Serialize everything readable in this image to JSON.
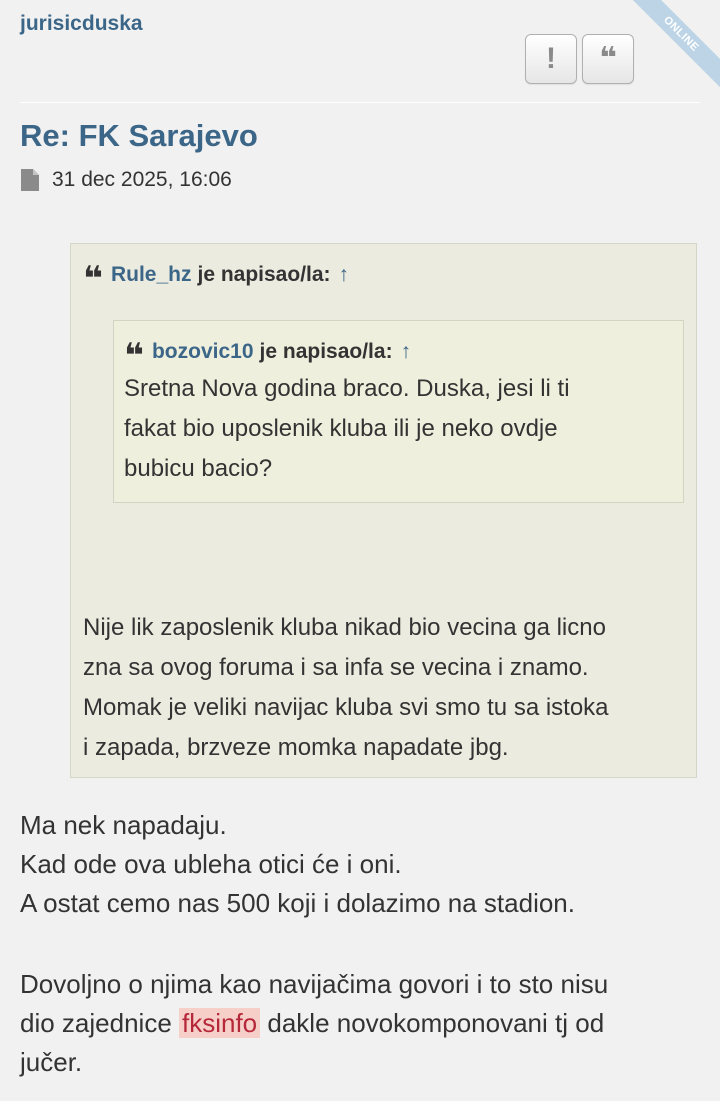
{
  "post": {
    "author": "jurisicduska",
    "online_label": "ONLINE",
    "buttons": {
      "report_glyph": "!",
      "quote_glyph": "❝"
    },
    "title": "Re: FK Sarajevo",
    "date": "31 dec 2025, 16:06",
    "icons": {
      "file": "file-icon",
      "quote": "quote-icon"
    }
  },
  "quote_outer": {
    "username": "Rule_hz",
    "said": "je napisao/la:",
    "arrow": "↑",
    "lines": [
      "Nije lik zaposlenik kluba nikad bio vecina ga licno",
      "zna sa ovog foruma i sa infa se vecina i znamo.",
      "Momak je veliki navijac kluba svi smo tu sa istoka",
      "i zapada, brzveze momka napadate jbg."
    ]
  },
  "quote_inner": {
    "username": "bozovic10",
    "said": "je napisao/la:",
    "arrow": "↑",
    "lines": [
      "Sretna Nova godina braco. Duska, jesi li ti",
      "fakat bio uposlenik kluba ili je neko ovdje",
      "bubicu bacio?"
    ]
  },
  "body": {
    "lines": [
      "Ma nek napadaju.",
      "Kad ode ova ubleha otici će i oni.",
      "A ostat cemo nas 500 koji i dolazimo na stadion."
    ],
    "para2_line1": "Dovoljno o njima kao navijačima govori i to sto nisu",
    "para2_line2_before": "dio zajednice ",
    "para2_highlight": "fksinfo",
    "para2_line2_after": " dakle novokomponovani tj od",
    "para2_line3": "jučer."
  },
  "colors": {
    "link": "#3c6688",
    "quote_bg": "#ebebe0",
    "highlight_bg": "#f6cfc9",
    "highlight_text": "#b5283a"
  }
}
